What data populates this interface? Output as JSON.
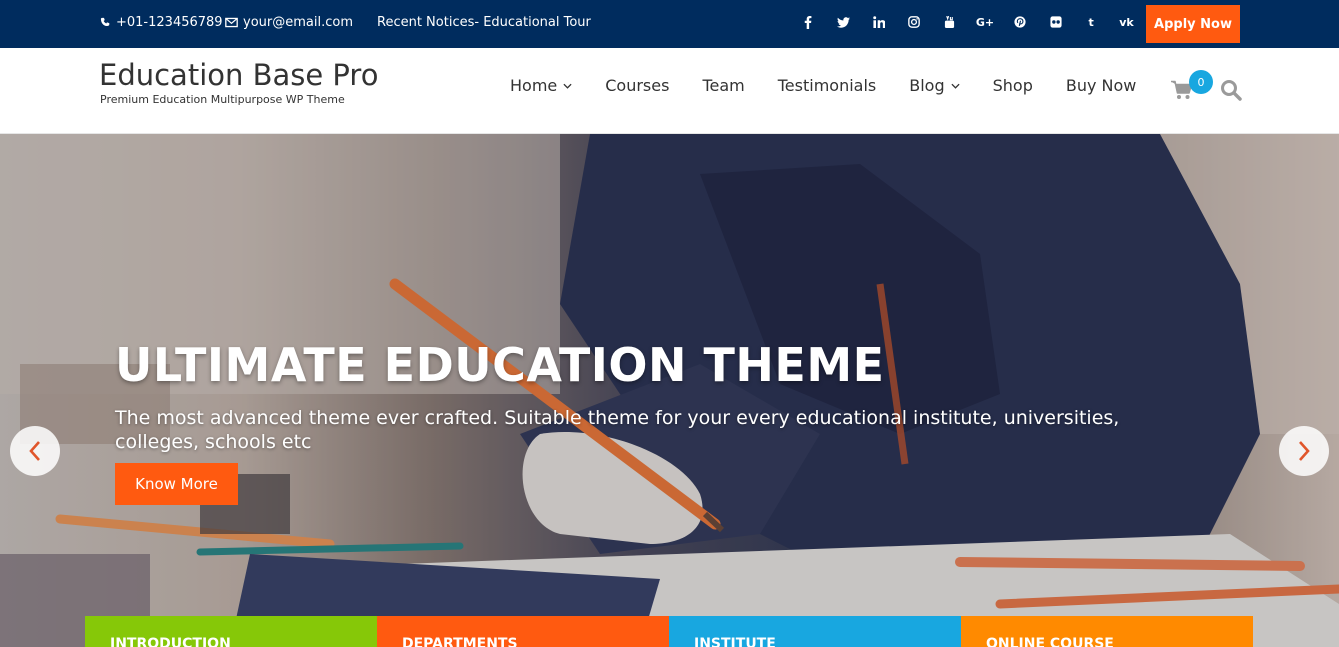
{
  "topbar": {
    "phone": "+01-123456789",
    "email": "your@email.com",
    "notice": "Recent Notices- Educational Tour",
    "apply_label": "Apply Now",
    "social_icons": [
      "facebook-icon",
      "twitter-icon",
      "linkedin-icon",
      "instagram-icon",
      "youtube-icon",
      "google-plus-icon",
      "pinterest-icon",
      "flickr-icon",
      "tumblr-icon",
      "vk-icon"
    ]
  },
  "header": {
    "site_title": "Education Base Pro",
    "tagline": "Premium Education Multipurpose WP Theme",
    "nav": [
      {
        "label": "Home",
        "dropdown": true
      },
      {
        "label": "Courses",
        "dropdown": false
      },
      {
        "label": "Team",
        "dropdown": false
      },
      {
        "label": "Testimonials",
        "dropdown": false
      },
      {
        "label": "Blog",
        "dropdown": true
      },
      {
        "label": "Shop",
        "dropdown": false
      },
      {
        "label": "Buy Now",
        "dropdown": false
      }
    ],
    "cart_count": "0"
  },
  "hero": {
    "title": "ULTIMATE EDUCATION THEME",
    "description": "The most advanced theme ever crafted. Suitable theme for your every educational institute, universities, colleges, schools etc",
    "button_label": "Know More"
  },
  "tiles": [
    {
      "label": "INTRODUCTION"
    },
    {
      "label": "DEPARTMENTS"
    },
    {
      "label": "INSTITUTE"
    },
    {
      "label": "ONLINE COURSE"
    }
  ],
  "colors": {
    "topbar_bg": "#002c5e",
    "accent_orange": "#ff5a10",
    "tile_green": "#86c808",
    "tile_blue": "#18a7e0",
    "tile_amber": "#ff8a00"
  }
}
